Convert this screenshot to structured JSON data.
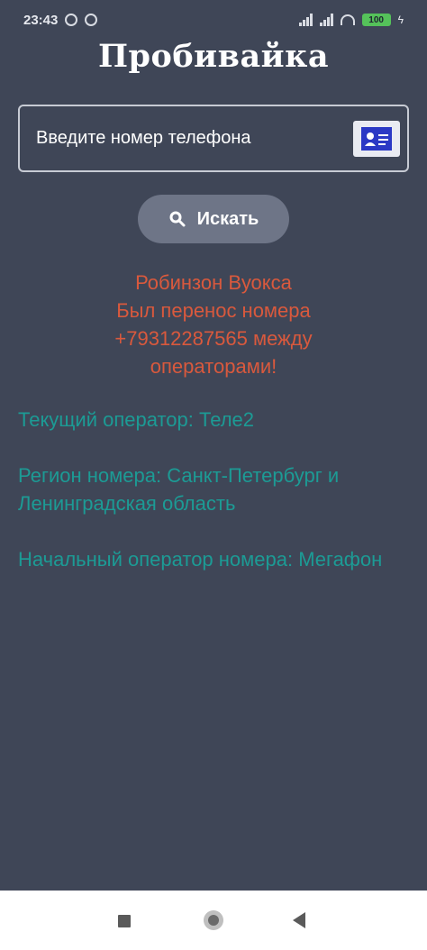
{
  "status_bar": {
    "time": "23:43",
    "battery": "100"
  },
  "app": {
    "title": "Пробивайка"
  },
  "phone_field": {
    "placeholder": "Введите номер телефона"
  },
  "search": {
    "label": "Искать"
  },
  "result": {
    "alert_lines": [
      "Робинзон Вуокса",
      "Был перенос номера",
      "+79312287565 между",
      "операторами!"
    ],
    "current_operator": "Текущий оператор: Теле2",
    "region": "Регион номера: Санкт-Петербург и Ленинградская область",
    "original_operator": "Начальный оператор номера: Мегафон"
  },
  "colors": {
    "background": "#3f4657",
    "alert": "#d9593d",
    "info": "#1c9b95",
    "button": "#6e7587"
  },
  "icons": {
    "search": "search-icon",
    "contacts": "contacts-icon"
  }
}
